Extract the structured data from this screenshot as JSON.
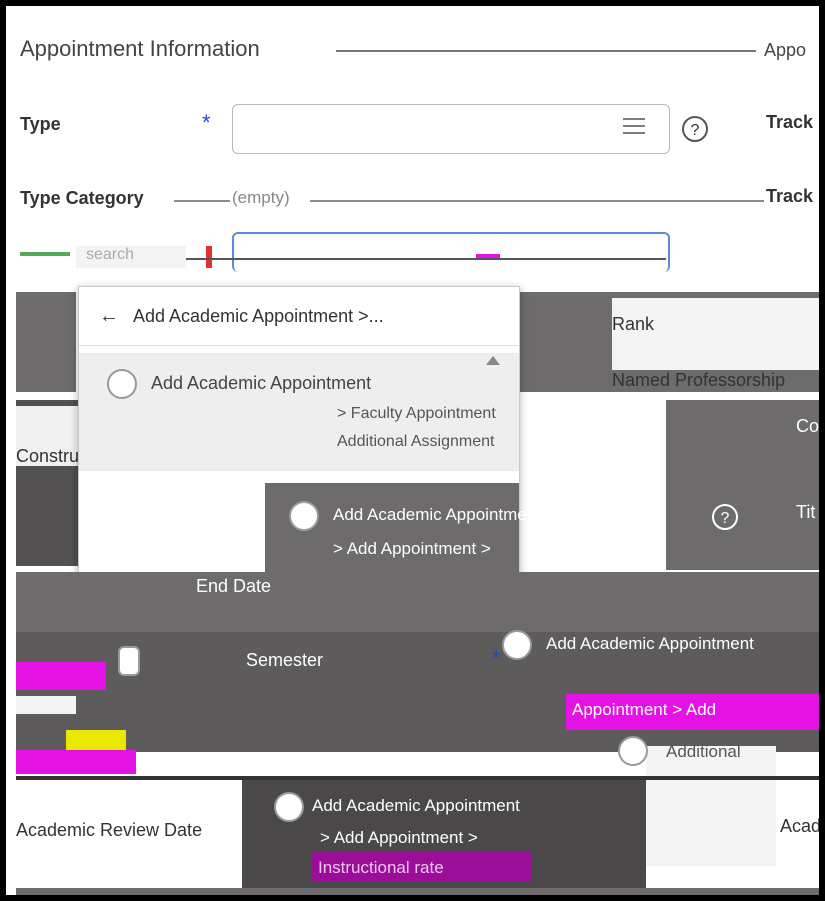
{
  "section": {
    "title": "Appointment Information",
    "right_clip": "Appo"
  },
  "fields": {
    "type_label": "Type",
    "type_category_label": "Type Category",
    "type_category_value": "(empty)",
    "track_label": "Track",
    "track2_label": "Track",
    "required_mark": "*",
    "help_glyph": "?"
  },
  "search": {
    "placeholder": "search"
  },
  "dropdown": {
    "back_label": "Add Academic Appointment >...",
    "options": [
      {
        "title": "Add Academic Appointment",
        "sub1": "> Faculty Appointment",
        "sub2": "Additional Assignment"
      },
      {
        "title": "Add Academic Appointment",
        "sub1": "> Add Appointment >"
      }
    ]
  },
  "background": {
    "rank_label": "Rank",
    "named_professorship_label": "Named Professorship",
    "constructed_title_label": "Constructed Title",
    "end_date_label": "End Date",
    "semester_label": "Semester",
    "academic_review_date_label": "Academic Review Date",
    "additional_label": "Additional",
    "appointment_label": "Appointment > Add",
    "add_academic_appointment": "Add Academic Appointment",
    "add_appointment": "> Add Appointment >",
    "acad_clip": "Acad",
    "co_clip": "Co",
    "tit_clip": "Tit",
    "instruct_label": "Instructional rate"
  },
  "icons": {
    "list": "list-icon",
    "help": "help-icon",
    "back": "arrow-left-icon",
    "radio": "radio-icon"
  },
  "colors": {
    "required_blue": "#1f49c8",
    "required_red": "#e0322f",
    "focus_border": "#5a8cd8",
    "glitch_magenta": "#e412e4"
  }
}
